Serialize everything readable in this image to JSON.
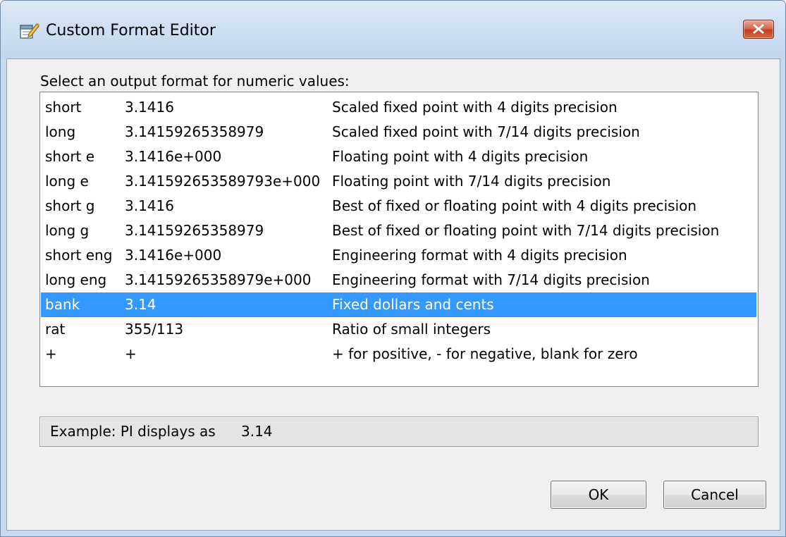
{
  "window": {
    "title": "Custom Format Editor"
  },
  "prompt": "Select an output format for numeric values:",
  "formats": [
    {
      "name": "short",
      "example": "3.1416",
      "description": "Scaled fixed point with 4 digits precision"
    },
    {
      "name": "long",
      "example": "3.14159265358979",
      "description": "Scaled fixed point with 7/14 digits precision"
    },
    {
      "name": "short e",
      "example": "3.1416e+000",
      "description": "Floating point with 4 digits precision"
    },
    {
      "name": "long e",
      "example": "3.141592653589793e+000",
      "description": "Floating point with 7/14 digits precision"
    },
    {
      "name": "short g",
      "example": "3.1416",
      "description": "Best of fixed or floating point with 4 digits precision"
    },
    {
      "name": "long g",
      "example": "3.14159265358979",
      "description": "Best of fixed or floating point with 7/14 digits precision"
    },
    {
      "name": "short eng",
      "example": "3.1416e+000",
      "description": "Engineering format with 4 digits precision"
    },
    {
      "name": "long eng",
      "example": "3.14159265358979e+000",
      "description": "Engineering format with 7/14 digits precision"
    },
    {
      "name": "bank",
      "example": "3.14",
      "description": "Fixed dollars and cents"
    },
    {
      "name": "rat",
      "example": "355/113",
      "description": "Ratio of small integers"
    },
    {
      "name": "+",
      "example": "+",
      "description": "+ for positive, - for negative, blank for zero"
    }
  ],
  "selected_format": "bank",
  "example": {
    "label": "Example:  PI displays as",
    "value": "3.14"
  },
  "buttons": {
    "ok_label": "OK",
    "cancel_label": "Cancel"
  },
  "icons": {
    "app": "format-editor-icon",
    "close": "close-icon"
  },
  "colors": {
    "selection": "#3399ff",
    "selection_text": "#ffffff",
    "close_button": "#c7472a"
  }
}
